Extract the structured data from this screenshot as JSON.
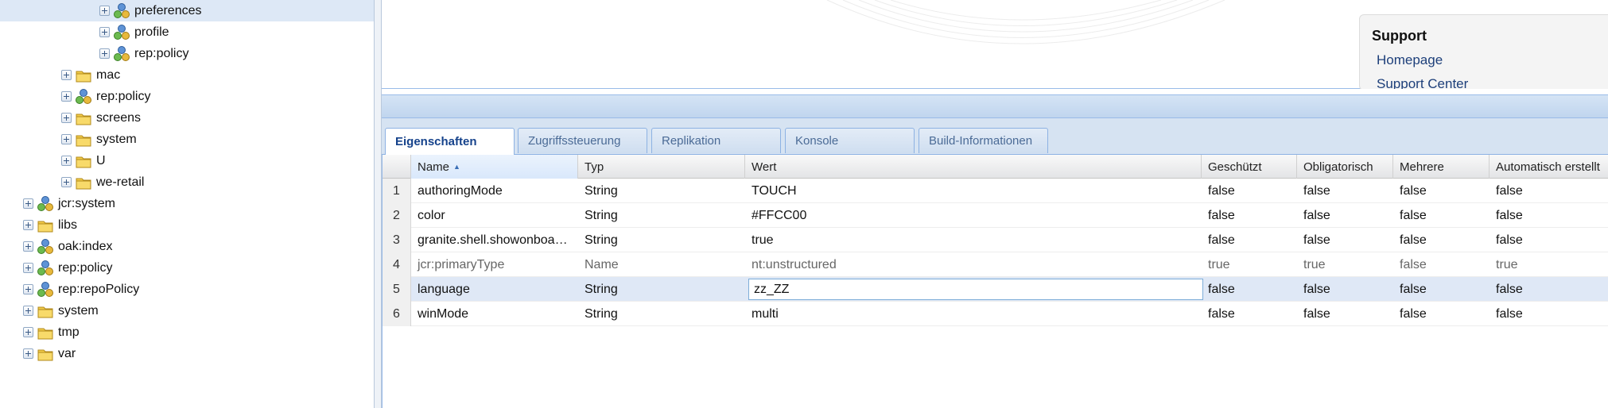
{
  "tree": {
    "nodes": [
      {
        "label": "preferences",
        "icon": "node-policy-icon",
        "selected": true
      },
      {
        "label": "profile",
        "icon": "node-policy-icon",
        "selected": false
      },
      {
        "label": "rep:policy",
        "icon": "node-policy-icon",
        "selected": false
      },
      {
        "label": "mac",
        "icon": "folder-icon",
        "selected": false
      },
      {
        "label": "rep:policy",
        "icon": "node-policy-icon",
        "selected": false
      },
      {
        "label": "screens",
        "icon": "folder-icon",
        "selected": false
      },
      {
        "label": "system",
        "icon": "folder-icon",
        "selected": false
      },
      {
        "label": "U",
        "icon": "folder-icon",
        "selected": false
      },
      {
        "label": "we-retail",
        "icon": "folder-icon",
        "selected": false
      },
      {
        "label": "jcr:system",
        "icon": "node-policy-icon",
        "selected": false
      },
      {
        "label": "libs",
        "icon": "folder-icon",
        "selected": false
      },
      {
        "label": "oak:index",
        "icon": "node-policy-icon",
        "selected": false
      },
      {
        "label": "rep:policy",
        "icon": "node-policy-icon",
        "selected": false
      },
      {
        "label": "rep:repoPolicy",
        "icon": "node-policy-icon",
        "selected": false
      },
      {
        "label": "system",
        "icon": "folder-icon",
        "selected": false
      },
      {
        "label": "tmp",
        "icon": "folder-icon",
        "selected": false
      },
      {
        "label": "var",
        "icon": "folder-icon",
        "selected": false
      }
    ]
  },
  "support": {
    "title": "Support",
    "links": [
      "Homepage",
      "Support Center"
    ]
  },
  "tabs": [
    {
      "label": "Eigenschaften",
      "active": true
    },
    {
      "label": "Zugriffssteuerung",
      "active": false
    },
    {
      "label": "Replikation",
      "active": false
    },
    {
      "label": "Konsole",
      "active": false
    },
    {
      "label": "Build-Informationen",
      "active": false
    }
  ],
  "grid": {
    "columns": [
      "Name",
      "Typ",
      "Wert",
      "Geschützt",
      "Obligatorisch",
      "Mehrere",
      "Automatisch erstellt"
    ],
    "sorted_column": "Name",
    "rows": [
      {
        "num": "1",
        "name": "authoringMode",
        "type": "String",
        "value": "TOUCH",
        "protected": "false",
        "mandatory": "false",
        "multiple": "false",
        "auto": "false",
        "muted": false,
        "editing": false
      },
      {
        "num": "2",
        "name": "color",
        "type": "String",
        "value": "#FFCC00",
        "protected": "false",
        "mandatory": "false",
        "multiple": "false",
        "auto": "false",
        "muted": false,
        "editing": false
      },
      {
        "num": "3",
        "name": "granite.shell.showonboa…",
        "type": "String",
        "value": "true",
        "protected": "false",
        "mandatory": "false",
        "multiple": "false",
        "auto": "false",
        "muted": false,
        "editing": false
      },
      {
        "num": "4",
        "name": "jcr:primaryType",
        "type": "Name",
        "value": "nt:unstructured",
        "protected": "true",
        "mandatory": "true",
        "multiple": "false",
        "auto": "true",
        "muted": true,
        "editing": false
      },
      {
        "num": "5",
        "name": "language",
        "type": "String",
        "value": "zz_ZZ",
        "protected": "false",
        "mandatory": "false",
        "multiple": "false",
        "auto": "false",
        "muted": false,
        "editing": true
      },
      {
        "num": "6",
        "name": "winMode",
        "type": "String",
        "value": "multi",
        "protected": "false",
        "mandatory": "false",
        "multiple": "false",
        "auto": "false",
        "muted": false,
        "editing": false
      }
    ]
  },
  "colors": {
    "selection": "#dde8f6",
    "panel_border": "#99bbe8",
    "active_tab_text": "#15428b",
    "link": "#1d3f7a"
  }
}
